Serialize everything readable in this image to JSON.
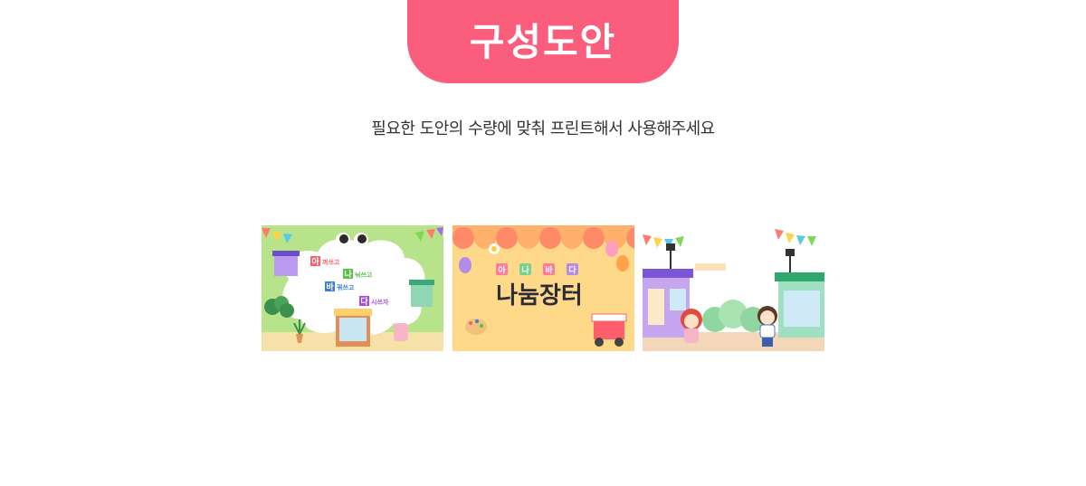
{
  "header": {
    "title": "구성도안",
    "subtitle": "필요한 도안의 수량에 맞춰 프린트해서 사용해주세요"
  },
  "colors": {
    "title_bg": "#fb5e7c",
    "subtitle_text": "#333333",
    "page_bg": "#ffffff"
  },
  "thumbnails": [
    {
      "rows": [
        {
          "syllable": "아",
          "text": "껴쓰고"
        },
        {
          "syllable": "나",
          "text": "눠쓰고"
        },
        {
          "syllable": "바",
          "text": "꿔쓰고"
        },
        {
          "syllable": "다",
          "text": "시쓰자"
        }
      ]
    },
    {
      "small_syllables": [
        "아",
        "나",
        "바",
        "다"
      ],
      "big_title": "나눔장터"
    },
    {}
  ]
}
